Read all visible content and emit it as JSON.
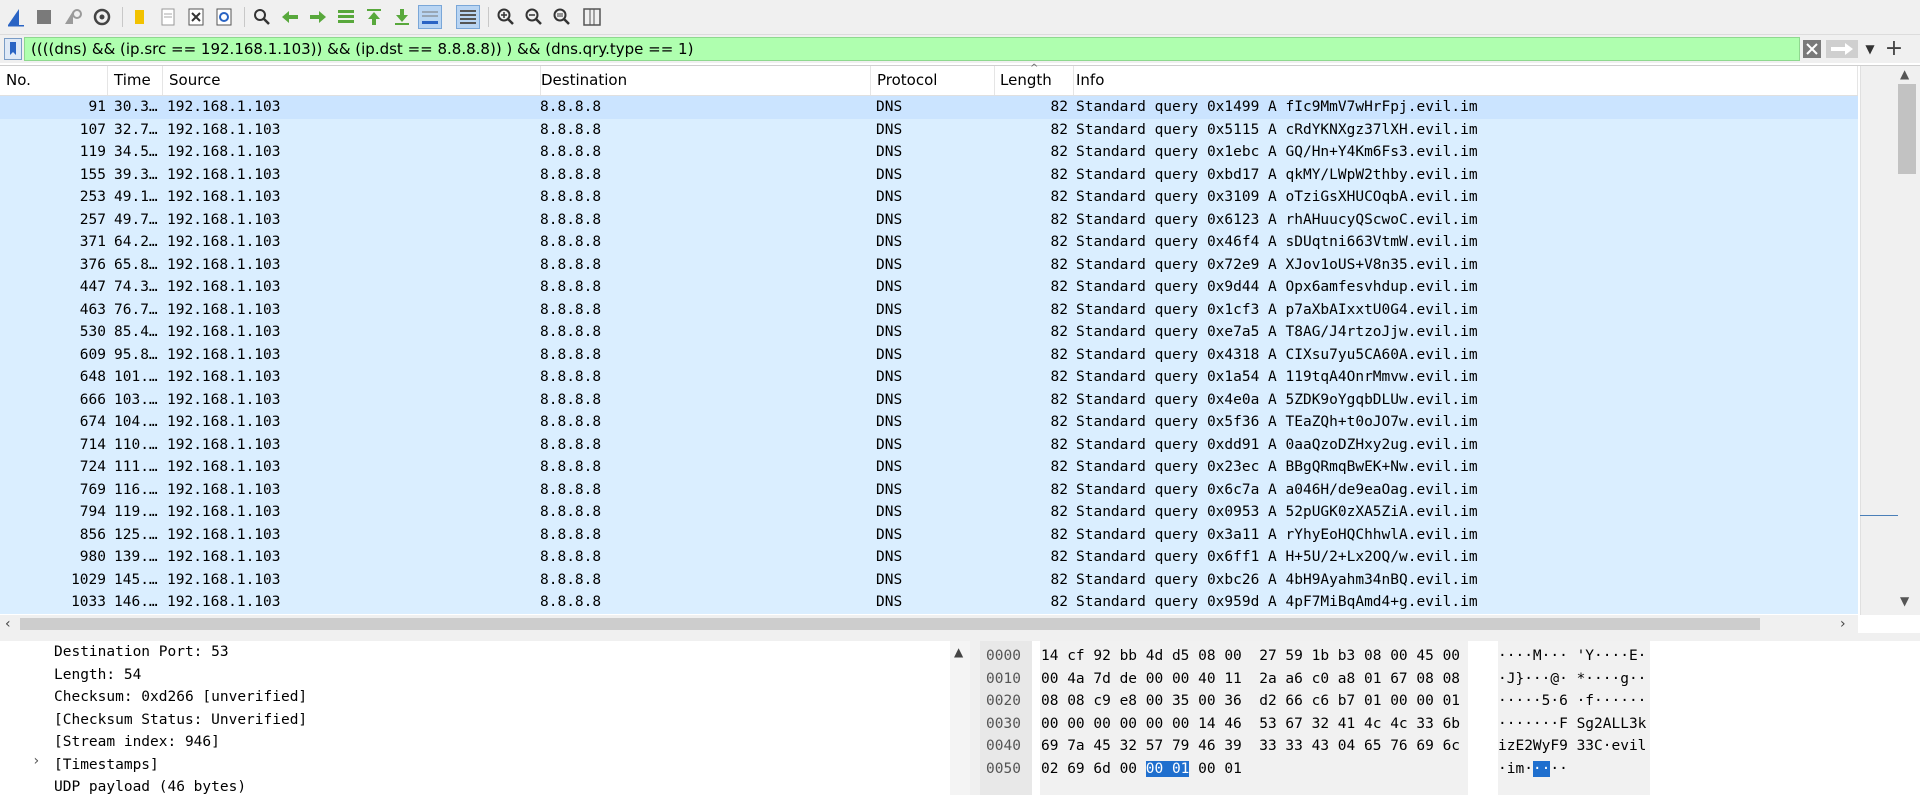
{
  "toolbar": {
    "icons": [
      "shark-fin-start-icon",
      "stop-icon",
      "restart-icon",
      "options-gear-icon",
      "open-folder-icon",
      "save-file-icon",
      "close-file-icon",
      "reload-icon",
      "find-icon",
      "back-arrow-icon",
      "forward-arrow-icon",
      "go-to-packet-icon",
      "first-packet-icon",
      "last-packet-icon",
      "autoscroll-icon",
      "colorize-icon",
      "zoom-in-icon",
      "zoom-out-icon",
      "normal-size-icon",
      "resize-columns-icon"
    ]
  },
  "filter": {
    "value": "((((dns) && (ip.src == 192.168.1.103)) && (ip.dst == 8.8.8.8)) ) && (dns.qry.type == 1)",
    "bg_color": "#afffaf"
  },
  "packet_list": {
    "columns": [
      "No.",
      "Time",
      "Source",
      "Destination",
      "Protocol",
      "Length",
      "Info"
    ],
    "row_color": "#daeeff",
    "rows": [
      {
        "no": "91",
        "time": "30.3…",
        "src": "192.168.1.103",
        "dst": "8.8.8.8",
        "proto": "DNS",
        "len": "82",
        "info": "Standard query 0x1499 A fIc9MmV7wHrFpj.evil.im"
      },
      {
        "no": "107",
        "time": "32.7…",
        "src": "192.168.1.103",
        "dst": "8.8.8.8",
        "proto": "DNS",
        "len": "82",
        "info": "Standard query 0x5115 A cRdYKNXgz37lXH.evil.im"
      },
      {
        "no": "119",
        "time": "34.5…",
        "src": "192.168.1.103",
        "dst": "8.8.8.8",
        "proto": "DNS",
        "len": "82",
        "info": "Standard query 0x1ebc A GQ/Hn+Y4Km6Fs3.evil.im"
      },
      {
        "no": "155",
        "time": "39.3…",
        "src": "192.168.1.103",
        "dst": "8.8.8.8",
        "proto": "DNS",
        "len": "82",
        "info": "Standard query 0xbd17 A qkMY/LWpW2thby.evil.im"
      },
      {
        "no": "253",
        "time": "49.1…",
        "src": "192.168.1.103",
        "dst": "8.8.8.8",
        "proto": "DNS",
        "len": "82",
        "info": "Standard query 0x3109 A oTziGsXHUCOqbA.evil.im"
      },
      {
        "no": "257",
        "time": "49.7…",
        "src": "192.168.1.103",
        "dst": "8.8.8.8",
        "proto": "DNS",
        "len": "82",
        "info": "Standard query 0x6123 A rhAHuucyQScwoC.evil.im"
      },
      {
        "no": "371",
        "time": "64.2…",
        "src": "192.168.1.103",
        "dst": "8.8.8.8",
        "proto": "DNS",
        "len": "82",
        "info": "Standard query 0x46f4 A sDUqtni663VtmW.evil.im"
      },
      {
        "no": "376",
        "time": "65.8…",
        "src": "192.168.1.103",
        "dst": "8.8.8.8",
        "proto": "DNS",
        "len": "82",
        "info": "Standard query 0x72e9 A XJov1oUS+V8n35.evil.im"
      },
      {
        "no": "447",
        "time": "74.3…",
        "src": "192.168.1.103",
        "dst": "8.8.8.8",
        "proto": "DNS",
        "len": "82",
        "info": "Standard query 0x9d44 A Opx6amfesvhdup.evil.im"
      },
      {
        "no": "463",
        "time": "76.7…",
        "src": "192.168.1.103",
        "dst": "8.8.8.8",
        "proto": "DNS",
        "len": "82",
        "info": "Standard query 0x1cf3 A p7aXbAIxxtU0G4.evil.im"
      },
      {
        "no": "530",
        "time": "85.4…",
        "src": "192.168.1.103",
        "dst": "8.8.8.8",
        "proto": "DNS",
        "len": "82",
        "info": "Standard query 0xe7a5 A T8AG/J4rtzoJjw.evil.im"
      },
      {
        "no": "609",
        "time": "95.8…",
        "src": "192.168.1.103",
        "dst": "8.8.8.8",
        "proto": "DNS",
        "len": "82",
        "info": "Standard query 0x4318 A CIXsu7yu5CA60A.evil.im"
      },
      {
        "no": "648",
        "time": "101.…",
        "src": "192.168.1.103",
        "dst": "8.8.8.8",
        "proto": "DNS",
        "len": "82",
        "info": "Standard query 0x1a54 A 119tqA4OnrMmvw.evil.im"
      },
      {
        "no": "666",
        "time": "103.…",
        "src": "192.168.1.103",
        "dst": "8.8.8.8",
        "proto": "DNS",
        "len": "82",
        "info": "Standard query 0x4e0a A 5ZDK9oYgqbDLUw.evil.im"
      },
      {
        "no": "674",
        "time": "104.…",
        "src": "192.168.1.103",
        "dst": "8.8.8.8",
        "proto": "DNS",
        "len": "82",
        "info": "Standard query 0x5f36 A TEaZQh+t0oJO7w.evil.im"
      },
      {
        "no": "714",
        "time": "110.…",
        "src": "192.168.1.103",
        "dst": "8.8.8.8",
        "proto": "DNS",
        "len": "82",
        "info": "Standard query 0xdd91 A 0aaQzoDZHxy2ug.evil.im"
      },
      {
        "no": "724",
        "time": "111.…",
        "src": "192.168.1.103",
        "dst": "8.8.8.8",
        "proto": "DNS",
        "len": "82",
        "info": "Standard query 0x23ec A BBgQRmqBwEK+Nw.evil.im"
      },
      {
        "no": "769",
        "time": "116.…",
        "src": "192.168.1.103",
        "dst": "8.8.8.8",
        "proto": "DNS",
        "len": "82",
        "info": "Standard query 0x6c7a A a046H/de9eaOag.evil.im"
      },
      {
        "no": "794",
        "time": "119.…",
        "src": "192.168.1.103",
        "dst": "8.8.8.8",
        "proto": "DNS",
        "len": "82",
        "info": "Standard query 0x0953 A 52pUGK0zXA5ZiA.evil.im"
      },
      {
        "no": "856",
        "time": "125.…",
        "src": "192.168.1.103",
        "dst": "8.8.8.8",
        "proto": "DNS",
        "len": "82",
        "info": "Standard query 0x3a11 A rYhyEoHQChhwlA.evil.im"
      },
      {
        "no": "980",
        "time": "139.…",
        "src": "192.168.1.103",
        "dst": "8.8.8.8",
        "proto": "DNS",
        "len": "82",
        "info": "Standard query 0x6ff1 A H+5U/2+Lx2OQ/w.evil.im"
      },
      {
        "no": "1029",
        "time": "145.…",
        "src": "192.168.1.103",
        "dst": "8.8.8.8",
        "proto": "DNS",
        "len": "82",
        "info": "Standard query 0xbc26 A 4bH9Ayahm34nBQ.evil.im"
      },
      {
        "no": "1033",
        "time": "146.…",
        "src": "192.168.1.103",
        "dst": "8.8.8.8",
        "proto": "DNS",
        "len": "82",
        "info": "Standard query 0x959d A 4pF7MiBqAmd4+g.evil.im"
      }
    ]
  },
  "details": {
    "lines": [
      "Destination Port: 53",
      "Length: 54",
      "Checksum: 0xd266 [unverified]",
      "[Checksum Status: Unverified]",
      "[Stream index: 946]",
      "[Timestamps]",
      "UDP payload (46 bytes)"
    ],
    "expander": "›"
  },
  "bytes": {
    "rows": [
      {
        "offset": "0000",
        "hex": "14 cf 92 bb 4d d5 08 00  27 59 1b b3 08 00 45 00",
        "ascii": "····M··· 'Y····E·"
      },
      {
        "offset": "0010",
        "hex": "00 4a 7d de 00 00 40 11  2a a6 c0 a8 01 67 08 08",
        "ascii": "·J}···@· *····g··"
      },
      {
        "offset": "0020",
        "hex": "08 08 c9 e8 00 35 00 36  d2 66 c6 b7 01 00 00 01",
        "ascii": "·····5·6 ·f······"
      },
      {
        "offset": "0030",
        "hex": "00 00 00 00 00 00 14 46  53 67 32 41 4c 4c 33 6b",
        "ascii": "·······F Sg2ALL3k"
      },
      {
        "offset": "0040",
        "hex": "69 7a 45 32 57 79 46 39  33 33 43 04 65 76 69 6c",
        "ascii": "izE2WyF9 33C·evil"
      },
      {
        "offset": "0050",
        "hex_pre": "02 69 6d 00 ",
        "hex_hl": "00 01",
        "hex_post": " 00 01",
        "ascii_pre": "·im·",
        "ascii_hl": "··",
        "ascii_post": "··"
      }
    ],
    "highlight_color": "#1f6fce"
  }
}
